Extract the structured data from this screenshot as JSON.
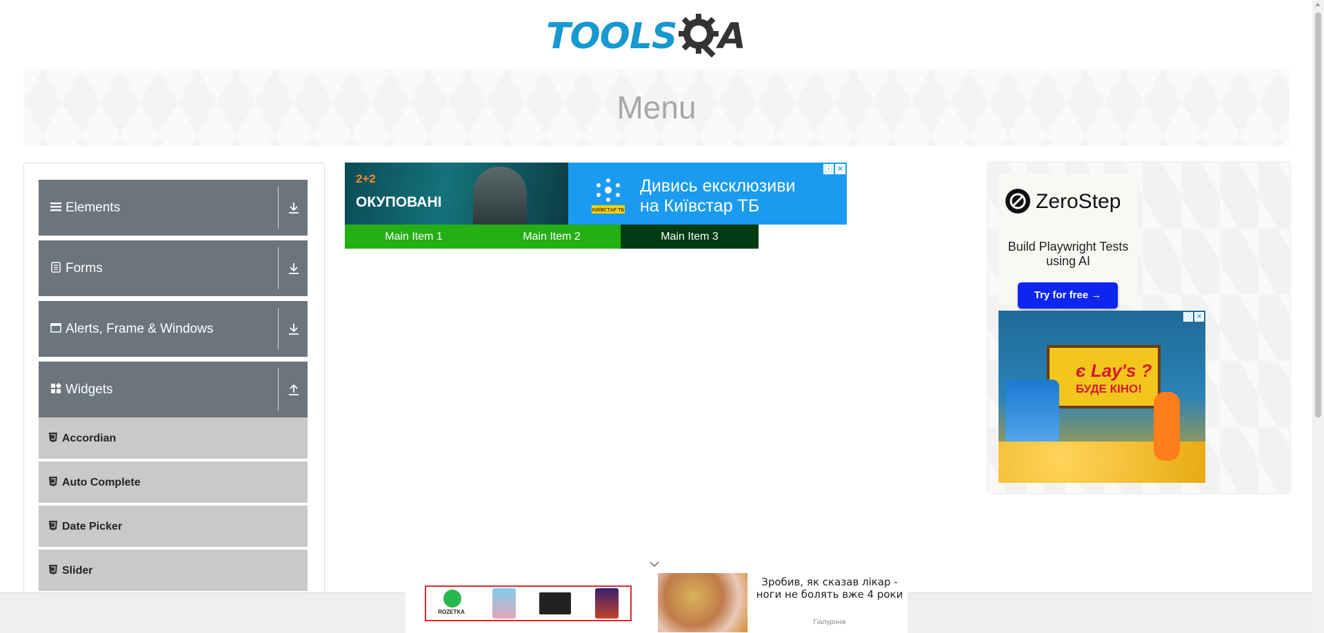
{
  "header": {
    "logo_text": "TOOLS",
    "logo_suffix": "A"
  },
  "banner": {
    "title": "Menu"
  },
  "sidebar": {
    "groups": [
      {
        "label": "Elements",
        "icon": "menu-lines-icon",
        "arrow": "download-icon"
      },
      {
        "label": "Forms",
        "icon": "document-icon",
        "arrow": "download-icon"
      },
      {
        "label": "Alerts, Frame & Windows",
        "icon": "window-icon",
        "arrow": "download-icon"
      },
      {
        "label": "Widgets",
        "icon": "widgets-grid-icon",
        "arrow": "upload-icon"
      }
    ],
    "widget_items": [
      {
        "label": "Accordian"
      },
      {
        "label": "Auto Complete"
      },
      {
        "label": "Date Picker"
      },
      {
        "label": "Slider"
      }
    ]
  },
  "ad_top": {
    "channel": "2+2",
    "show": "ОКУПОВАНІ",
    "headline_line1": "Дивись ексклюзиви",
    "headline_line2": "на Київстар ТБ",
    "brand_label": "КИЇВСТАР ТБ"
  },
  "nav": {
    "items": [
      {
        "label": "Main Item 1"
      },
      {
        "label": "Main Item 2"
      },
      {
        "label": "Main Item 3"
      }
    ]
  },
  "ad_side": {
    "zerostep_name": "ZeroStep",
    "zerostep_tagline": "Build Playwright Tests using AI",
    "zerostep_button": "Try for free →",
    "lays_brand": "є Lay's ?",
    "lays_tag": "БУДЕ КІНО!"
  },
  "ad_bottom": {
    "rozetka_label": "ROZETKA",
    "news_text": "Зробив, як сказав лікар - ноги не болять вже 4 роки",
    "news_source": "Гіалуронік"
  },
  "colors": {
    "logo_blue": "#1798d1",
    "sidebar_group": "#6c757d",
    "sidebar_sub": "#c9c9c9",
    "nav_green": "#24af15",
    "nav_dark": "#003b11",
    "zerostep_button": "#0d25ee"
  }
}
